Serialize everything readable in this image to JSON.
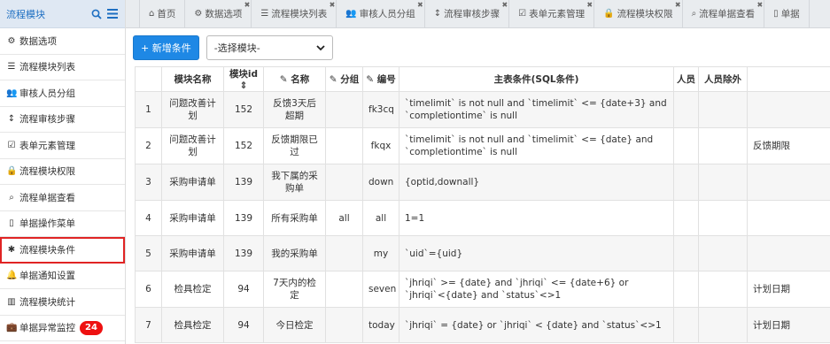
{
  "sidebar": {
    "title": "流程模块",
    "items": [
      {
        "label": "数据选项",
        "icon": "gear-icon"
      },
      {
        "label": "流程模块列表",
        "icon": "list-icon"
      },
      {
        "label": "审核人员分组",
        "icon": "users-icon"
      },
      {
        "label": "流程审核步骤",
        "icon": "step-icon"
      },
      {
        "label": "表单元素管理",
        "icon": "checkbox-icon"
      },
      {
        "label": "流程模块权限",
        "icon": "lock-icon"
      },
      {
        "label": "流程单据查看",
        "icon": "search-icon"
      },
      {
        "label": "单据操作菜单",
        "icon": "bookmark-icon"
      },
      {
        "label": "流程模块条件",
        "icon": "asterisk-icon"
      },
      {
        "label": "单据通知设置",
        "icon": "bell-icon"
      },
      {
        "label": "流程模块统计",
        "icon": "chart-icon"
      },
      {
        "label": "单据异常监控",
        "icon": "briefcase-icon",
        "badge": "24"
      }
    ]
  },
  "tabs": [
    {
      "label": "首页",
      "icon": "home-icon",
      "closable": false
    },
    {
      "label": "数据选项",
      "icon": "gear-icon",
      "closable": true
    },
    {
      "label": "流程模块列表",
      "icon": "list-icon",
      "closable": true
    },
    {
      "label": "审核人员分组",
      "icon": "users-icon",
      "closable": true
    },
    {
      "label": "流程审核步骤",
      "icon": "step-icon",
      "closable": true
    },
    {
      "label": "表单元素管理",
      "icon": "checkbox-icon",
      "closable": true
    },
    {
      "label": "流程模块权限",
      "icon": "lock-icon",
      "closable": true
    },
    {
      "label": "流程单据查看",
      "icon": "search-icon",
      "closable": true
    },
    {
      "label": "单据",
      "icon": "bookmark-icon",
      "closable": false
    }
  ],
  "toolbar": {
    "add_label": "+ 新增条件",
    "select_value": "-选择模块-"
  },
  "table": {
    "headers": [
      "",
      "模块名称",
      "模块id ⇕",
      "✎ 名称",
      "✎ 分组",
      "✎ 编号",
      "主表条件(SQL条件)",
      "人员",
      "人员除外",
      ""
    ],
    "rows": [
      [
        "1",
        "问题改善计划",
        "152",
        "反馈3天后超期",
        "",
        "fk3cq",
        "`timelimit` is not null and `timelimit` <= {date+3} and `completiontime` is null",
        "",
        "",
        ""
      ],
      [
        "2",
        "问题改善计划",
        "152",
        "反馈期限已过",
        "",
        "fkqx",
        "`timelimit` is not null and `timelimit` <= {date} and `completiontime` is null",
        "",
        "",
        "反馈期限"
      ],
      [
        "3",
        "采购申请单",
        "139",
        "我下属的采购单",
        "",
        "down",
        "{optid,downall}",
        "",
        "",
        ""
      ],
      [
        "4",
        "采购申请单",
        "139",
        "所有采购单",
        "all",
        "all",
        "1=1",
        "",
        "",
        ""
      ],
      [
        "5",
        "采购申请单",
        "139",
        "我的采购单",
        "",
        "my",
        "`uid`={uid}",
        "",
        "",
        ""
      ],
      [
        "6",
        "检具检定",
        "94",
        "7天内的检定",
        "",
        "seven",
        "`jhriqi` >= {date} and `jhriqi` <= {date+6} or `jhriqi`<{date} and `status`<>1",
        "",
        "",
        "计划日期"
      ],
      [
        "7",
        "检具检定",
        "94",
        "今日检定",
        "",
        "today",
        "`jhriqi` = {date} or `jhriqi` < {date} and `status`<>1",
        "",
        "",
        "计划日期"
      ]
    ]
  }
}
